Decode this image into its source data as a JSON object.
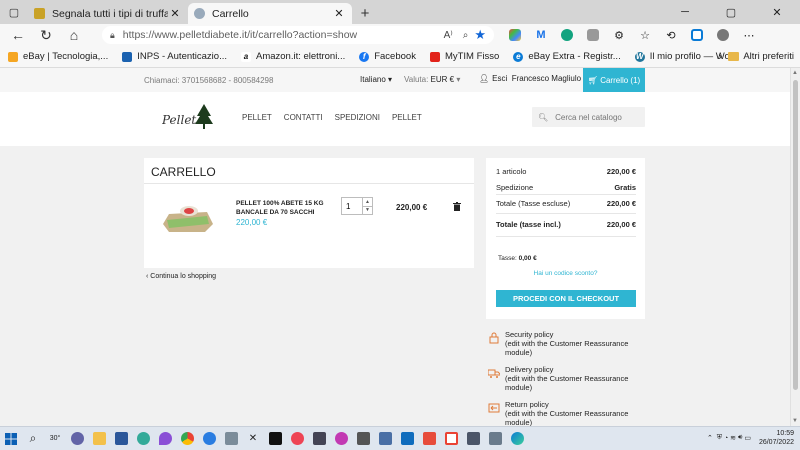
{
  "browser": {
    "tabs": [
      {
        "title": "Segnala tutti i tipi di truffa | Mod",
        "active": false
      },
      {
        "title": "Carrello",
        "active": true
      }
    ],
    "url": "https://www.pelletdiabete.it/it/carrello?action=show",
    "bookmarks": [
      "eBay | Tecnologia,...",
      "INPS - Autenticazio...",
      "Amazon.it: elettroni...",
      "Facebook",
      "MyTIM Fisso",
      "eBay Extra - Registr...",
      "Il mio profilo — Wo..."
    ],
    "other_bookmarks": "Altri preferiti"
  },
  "shop": {
    "call": "Chiamaci: 3701568682 - 800584298",
    "language": "Italiano",
    "currency_label": "Valuta:",
    "currency": "EUR €",
    "logout": "Esci",
    "user": "Francesco Magliulo",
    "cart_button": "Carrello (1)",
    "logo_text": "Pellet",
    "menu": [
      "PELLET",
      "CONTATTI",
      "SPEDIZIONI",
      "PELLET"
    ],
    "search_placeholder": "Cerca nel catalogo"
  },
  "cart": {
    "title": "CARRELLO",
    "item": {
      "name": "PELLET 100% ABETE 15 KG BANCALE DA 70 SACCHI",
      "price": "220,00 €",
      "quantity": "1",
      "total": "220,00 €"
    },
    "continue": "Continua lo shopping"
  },
  "summary": {
    "items_label": "1 articolo",
    "items_value": "220,00 €",
    "shipping_label": "Spedizione",
    "shipping_value": "Gratis",
    "total_excl_label": "Totale (Tasse escluse)",
    "total_excl_value": "220,00 €",
    "total_incl_label": "Totale (tasse incl.)",
    "total_incl_value": "220,00 €",
    "tax_label": "Tasse:",
    "tax_value": "0,00 €",
    "coupon": "Hai un codice sconto?",
    "checkout": "PROCEDI CON IL CHECKOUT"
  },
  "reassurance": [
    {
      "title": "Security policy",
      "text": "(edit with the Customer Reassurance module)"
    },
    {
      "title": "Delivery policy",
      "text": "(edit with the Customer Reassurance module)"
    },
    {
      "title": "Return policy",
      "text": "(edit with the Customer Reassurance module)"
    }
  ],
  "taskbar": {
    "weather": "30°",
    "time": "10:59",
    "date": "26/07/2022"
  },
  "colors": {
    "accent": "#2fb5d2",
    "edge_blue": "#1266d6"
  }
}
